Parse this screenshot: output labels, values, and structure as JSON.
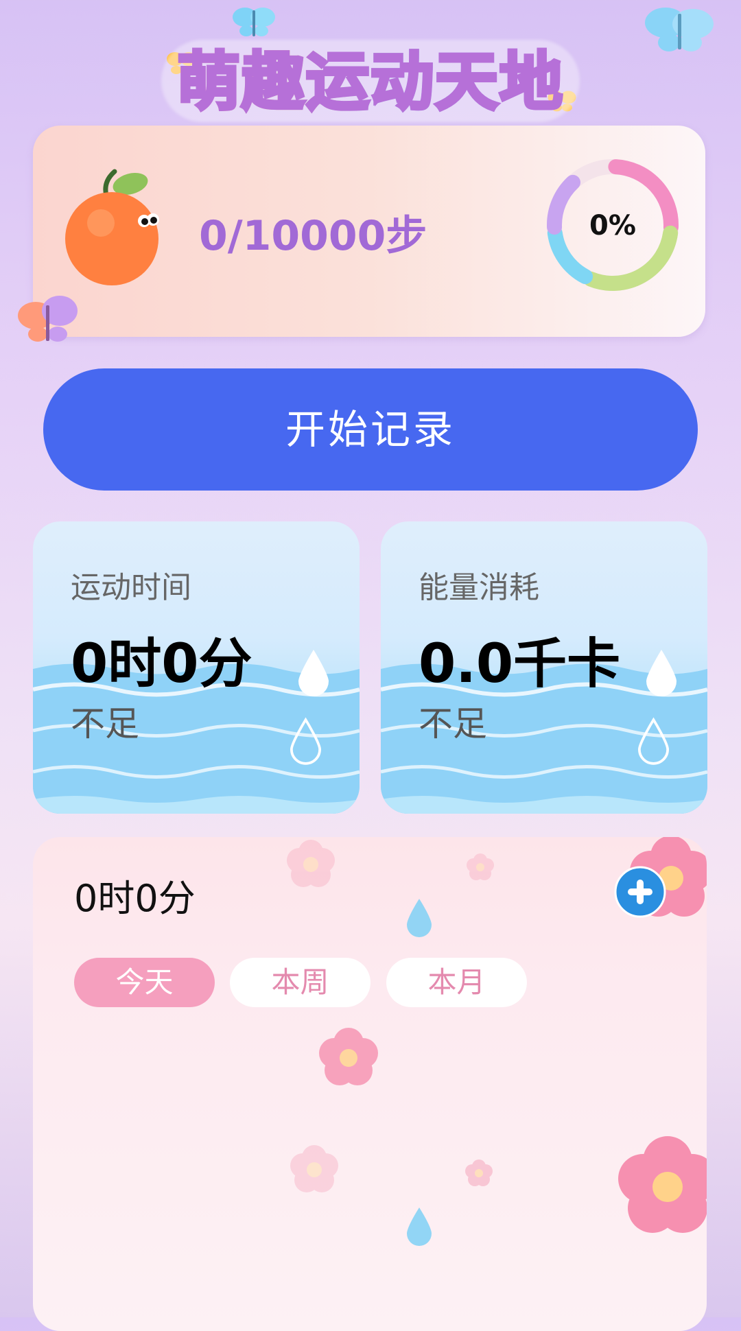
{
  "app": {
    "title": "萌趣运动天地"
  },
  "steps": {
    "text": "0/10000步",
    "progress_fraction": 0,
    "progress_label": "0%"
  },
  "start_button": {
    "label": "开始记录"
  },
  "stats": {
    "exercise_time": {
      "label": "运动时间",
      "value": "0时0分",
      "status": "不足"
    },
    "energy": {
      "label": "能量消耗",
      "value": "0.0千卡",
      "status": "不足"
    }
  },
  "records": {
    "total_time": "0时0分",
    "tabs": [
      {
        "label": "今天",
        "active": true
      },
      {
        "label": "本周",
        "active": false
      },
      {
        "label": "本月",
        "active": false
      }
    ]
  },
  "icons": {
    "mascot": "orange-mascot-icon",
    "add": "plus-circle-icon",
    "decor": [
      "butterfly-icon",
      "flower-icon",
      "water-drop-icon"
    ]
  },
  "colors": {
    "accent": "#4768f0",
    "steps_text": "#a169d6",
    "tab_active": "#f59fbe",
    "tab_inactive_text": "#e48aae",
    "ring": [
      "#f38ec3",
      "#c5e08a",
      "#7fd6f4",
      "#c8a4f0"
    ]
  }
}
